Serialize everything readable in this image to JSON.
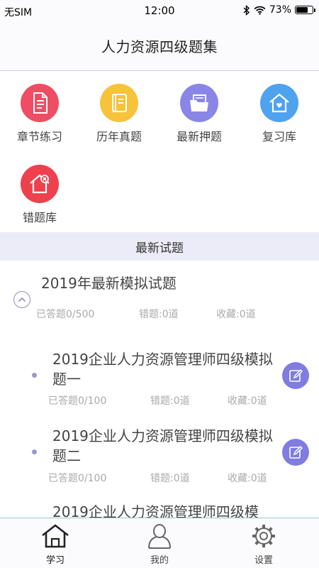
{
  "status_bar": {
    "carrier": "无SIM",
    "time": "12:00",
    "battery": "73%",
    "battery_level": 0.73
  },
  "header": {
    "title": "人力资源四级题集"
  },
  "grid": [
    {
      "label": "章节练习",
      "icon": "document-icon",
      "color": "#ef4d63"
    },
    {
      "label": "历年真题",
      "icon": "book-icon",
      "color": "#f6c33b"
    },
    {
      "label": "最新押题",
      "icon": "folder-icon",
      "color": "#8a86e6"
    },
    {
      "label": "复习库",
      "icon": "home-heart-icon",
      "color": "#4fa2ee"
    },
    {
      "label": "错题库",
      "icon": "home-error-icon",
      "color": "#ef404e"
    }
  ],
  "section": {
    "title": "最新试题"
  },
  "list": {
    "group": {
      "title": "2019年最新模拟试题",
      "answered": "已答题0/500",
      "wrong": "错题:0道",
      "fav": "收藏:0道"
    },
    "items": [
      {
        "title": "2019企业人力资源管理师四级模拟题一",
        "answered": "已答题0/100",
        "wrong": "错题:0道",
        "fav": "收藏:0道"
      },
      {
        "title": "2019企业人力资源管理师四级模拟题二",
        "answered": "已答题0/100",
        "wrong": "错题:0道",
        "fav": "收藏:0道"
      },
      {
        "title": "2019企业人力资源管理师四级模"
      }
    ]
  },
  "tabs": [
    {
      "label": "学习",
      "icon": "home-icon",
      "active": true
    },
    {
      "label": "我的",
      "icon": "user-icon",
      "active": false
    },
    {
      "label": "设置",
      "icon": "gear-icon",
      "active": false
    }
  ],
  "colors": {
    "accent": "#7f7de0",
    "section_bg": "#ecebf8",
    "tab_border": "#9ec9c4"
  }
}
